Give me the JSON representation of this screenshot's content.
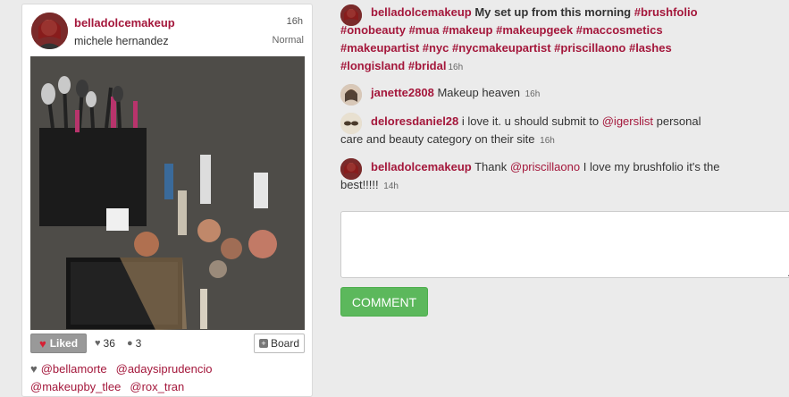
{
  "post": {
    "username": "belladolcemakeup",
    "full_name": "michele hernandez",
    "time": "16h",
    "filter": "Normal",
    "liked_label": "Liked",
    "likes_count": "36",
    "comments_count": "3",
    "board_label": "Board",
    "likers": [
      "@bellamorte",
      "@adaysiprudencio",
      "@makeupby_tlee",
      "@rox_tran"
    ]
  },
  "caption": {
    "username": "belladolcemakeup",
    "text": "My set up from this morning",
    "hashtags_line1": "#brushfolio",
    "hashtags_line2": "#onobeauty #mua #makeup #makeupgeek #maccosmetics",
    "hashtags_line3": "#makeupartist #nyc #nycmakeupartist #priscillaono #lashes",
    "hashtags_line4": "#longisland #bridal",
    "time": "16h"
  },
  "comments": [
    {
      "username": "janette2808",
      "text": "Makeup heaven",
      "time": "16h"
    },
    {
      "username": "deloresdaniel28",
      "text_before": "i love it. u should submit to",
      "mention": "@igerslist",
      "text_after": "personal",
      "text_line2": "care and beauty category on their site",
      "time": "16h"
    },
    {
      "username": "belladolcemakeup",
      "text_before": "Thank",
      "mention": "@priscillaono",
      "text_after": "I love my brushfolio it's the",
      "text_line2": "best!!!!!",
      "time": "14h"
    }
  ],
  "comment_input": {
    "value": "",
    "placeholder": ""
  },
  "comment_button": "COMMENT",
  "colors": {
    "accent": "#a4173b",
    "button_green": "#5cb85c",
    "background": "#ebebeb"
  },
  "icons": [
    "heart-icon",
    "comment-bubble-icon",
    "plus-icon"
  ]
}
